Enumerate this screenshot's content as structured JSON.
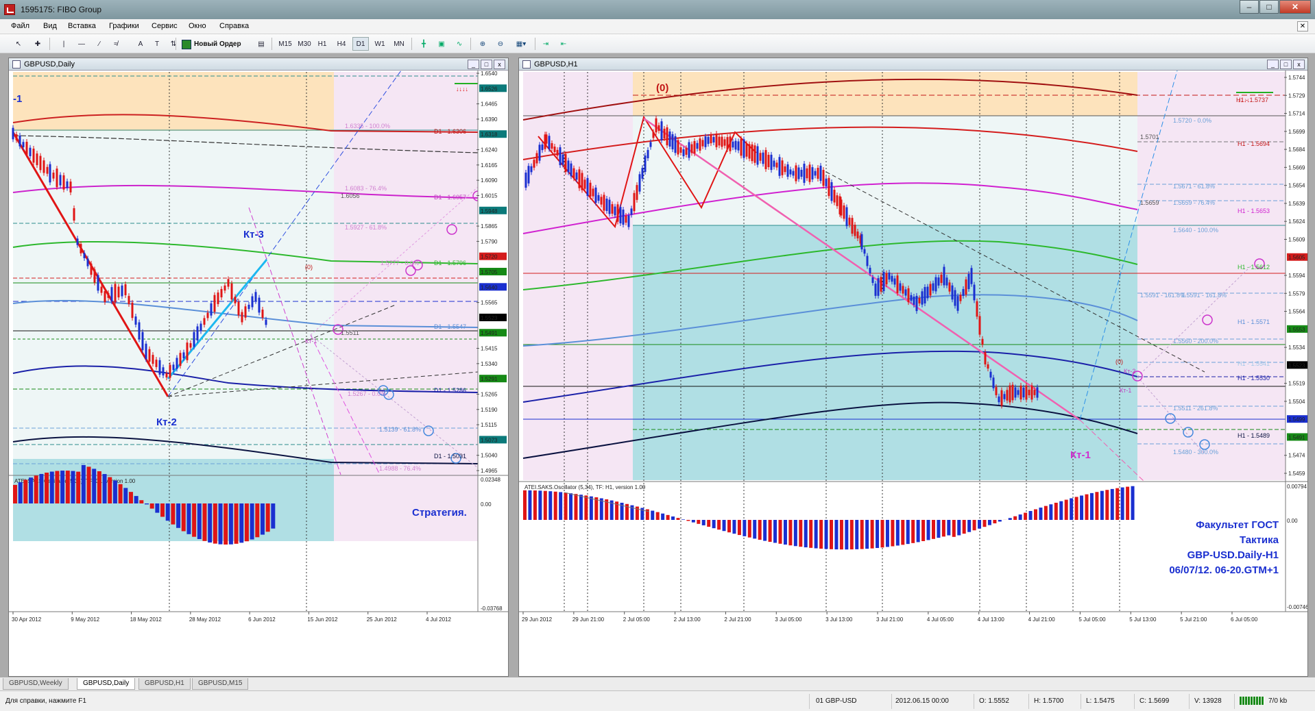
{
  "window": {
    "title": "1595175: FIBO Group"
  },
  "menu": [
    "Файл",
    "Вид",
    "Вставка",
    "Графики",
    "Сервис",
    "Окно",
    "Справка"
  ],
  "toolbar": {
    "new_order": "Новый Ордер",
    "timeframes": [
      "M15",
      "M30",
      "H1",
      "H4",
      "D1",
      "W1",
      "MN"
    ],
    "active_timeframe": "D1"
  },
  "left_chart": {
    "title": "GBPUSD,Daily",
    "prices": [
      {
        "v": "1.6540",
        "hl": false
      },
      {
        "v": "1.6526",
        "hl": "#0b7a7a"
      },
      {
        "v": "1.6465",
        "hl": false
      },
      {
        "v": "1.6390",
        "hl": false
      },
      {
        "v": "1.6318",
        "hl": "#0b7a7a"
      },
      {
        "v": "1.6240",
        "hl": false
      },
      {
        "v": "1.6165",
        "hl": false
      },
      {
        "v": "1.6090",
        "hl": false
      },
      {
        "v": "1.6015",
        "hl": false
      },
      {
        "v": "1.5948",
        "hl": "#0b7a7a"
      },
      {
        "v": "1.5865",
        "hl": false
      },
      {
        "v": "1.5790",
        "hl": false
      },
      {
        "v": "1.5720",
        "hl": "#d41c1c"
      },
      {
        "v": "1.5705",
        "hl": "#168a16"
      },
      {
        "v": "1.5640",
        "hl": "#1a2fd0"
      },
      {
        "v": "1.5565",
        "hl": false
      },
      {
        "v": "1.5523",
        "hl": "#000000"
      },
      {
        "v": "1.5491",
        "hl": "#168a16"
      },
      {
        "v": "1.5415",
        "hl": false
      },
      {
        "v": "1.5340",
        "hl": false
      },
      {
        "v": "1.5291",
        "hl": "#168a16"
      },
      {
        "v": "1.5265",
        "hl": false
      },
      {
        "v": "1.5190",
        "hl": false
      },
      {
        "v": "1.5115",
        "hl": false
      },
      {
        "v": "1.5073",
        "hl": "#0b7a7a"
      },
      {
        "v": "1.5040",
        "hl": false
      },
      {
        "v": "1.4965",
        "hl": false
      }
    ],
    "dates": [
      "30 Apr 2012",
      "9 May 2012",
      "18 May 2012",
      "28 May 2012",
      "6 Jun 2012",
      "15 Jun 2012",
      "25 Jun 2012",
      "4 Jul 2012"
    ],
    "labels": {
      "kt3": "Кт-3",
      "kt2": "Кт-2",
      "kt1": "Кт-1",
      "zero": "(0)",
      "m1": "-1",
      "d1_6306": "D1 - 1.6306",
      "d1_6057": "D1 - 1.6057",
      "d1_5796": "D1 - 1.5796",
      "d1_5547": "D1 - 1.5547",
      "d1_5286": "D1 - 1.5286",
      "d1_5031": "D1 - 1.5031",
      "f6335": "1.6335 - 100.0%",
      "f6083": "1.6083 - 76.4%",
      "f6056": "1.6056",
      "f5927": "1.5927 - 61.8%",
      "f5777": "1.5777 - 0.0%",
      "f5511": "1.5511",
      "f5267": "1.5267 - 0.0%",
      "f5139": "1.5139 - 61.8%",
      "f4988": "1.4988 - 76.4%"
    },
    "osc": {
      "title": "ATEI.SAKS.Oscillator (5,34), TF: D1, version 1.00",
      "top": "0.02348",
      "zero": "0.00",
      "bottom": "-0.03768",
      "strategy": "Стратегия."
    }
  },
  "right_chart": {
    "title": "GBPUSD,H1",
    "prices": [
      {
        "v": "1.5744",
        "hl": false
      },
      {
        "v": "1.5729",
        "hl": false
      },
      {
        "v": "1.5714",
        "hl": false
      },
      {
        "v": "1.5699",
        "hl": false
      },
      {
        "v": "1.5684",
        "hl": false
      },
      {
        "v": "1.5669",
        "hl": false
      },
      {
        "v": "1.5654",
        "hl": false
      },
      {
        "v": "1.5639",
        "hl": false
      },
      {
        "v": "1.5624",
        "hl": false
      },
      {
        "v": "1.5609",
        "hl": false
      },
      {
        "v": "1.5605",
        "hl": "#d41c1c"
      },
      {
        "v": "1.5594",
        "hl": false
      },
      {
        "v": "1.5579",
        "hl": false
      },
      {
        "v": "1.5564",
        "hl": false
      },
      {
        "v": "1.5553",
        "hl": "#168a16"
      },
      {
        "v": "1.5534",
        "hl": false
      },
      {
        "v": "1.5523",
        "hl": "#000000"
      },
      {
        "v": "1.5519",
        "hl": false
      },
      {
        "v": "1.5504",
        "hl": false
      },
      {
        "v": "1.5499",
        "hl": "#1a2fd0"
      },
      {
        "v": "1.5491",
        "hl": "#168a16"
      },
      {
        "v": "1.5474",
        "hl": false
      },
      {
        "v": "1.5459",
        "hl": false
      }
    ],
    "dates": [
      "29 Jun 2012",
      "29 Jun 21:00",
      "2 Jul 05:00",
      "2 Jul 13:00",
      "2 Jul 21:00",
      "3 Jul 05:00",
      "3 Jul 13:00",
      "3 Jul 21:00",
      "4 Jul 05:00",
      "4 Jul 13:00",
      "4 Jul 21:00",
      "5 Jul 05:00",
      "5 Jul 13:00",
      "5 Jul 21:00",
      "6 Jul 05:00"
    ],
    "labels": {
      "zero": "(0)",
      "kt1": "Кт-1",
      "kt1s": "Кт-1",
      "kt2": "Кт-2",
      "z2": "(0)",
      "f5720": "1.5720 - 0.0%",
      "f5701": "1.5701",
      "h1_5694": "H1 - 1.5694",
      "f5671": "1.5671 - 61.8%",
      "f5659": "1.5659",
      "f5659b": "1.5659 - 76.4%",
      "h1_5653": "H1 - 1.5653",
      "f5640": "1.5640 - 100.0%",
      "h1_5612": "H1 - 1.5612",
      "f5591": "1.5591 - 161.8%",
      "f5591b": "1.5591 - 161.8%",
      "h1_5571": "H1 - 1.5571",
      "f5560": "1.5560 - 200.0%",
      "f5541": "H1 - 1.5541",
      "h1_5530": "H1 - 1.5530",
      "f5511": "1.5511 - 261.8%",
      "h1_5489": "H1 - 1.5489",
      "f5480": "1.5480 - 300.0%",
      "h1_5737": "H1 - 1.5737"
    },
    "osc": {
      "title": "ATEI.SAKS.Oscillator (5,34), TF: H1, version 1.00",
      "top": "0.00794",
      "zero": "0.00",
      "bottom": "-0.00746"
    },
    "summary": [
      "Факультет ГОСТ",
      "Тактика",
      "GBP-USD.Daily-H1",
      "06/07/12. 06-20.GTM+1"
    ]
  },
  "tabs": [
    "GBPUSD,Weekly",
    "GBPUSD,Daily",
    "GBPUSD,H1",
    "GBPUSD,M15"
  ],
  "active_tab": "GBPUSD,Daily",
  "status": {
    "help": "Для справки, нажмите F1",
    "profile": "01 GBP-USD",
    "time": "2012.06.15 00:00",
    "open": "O: 1.5552",
    "high": "H: 1.5700",
    "low": "L: 1.5475",
    "close": "C: 1.5699",
    "volume": "V: 13928",
    "traffic": "7/0 kb"
  },
  "colors": {
    "up_candle": "#1a2fd0",
    "down_candle": "#e01515",
    "fib_pink": "#f0cde9",
    "fib_cyan": "#b0dfe4",
    "fib_orange": "#fde3bc"
  }
}
